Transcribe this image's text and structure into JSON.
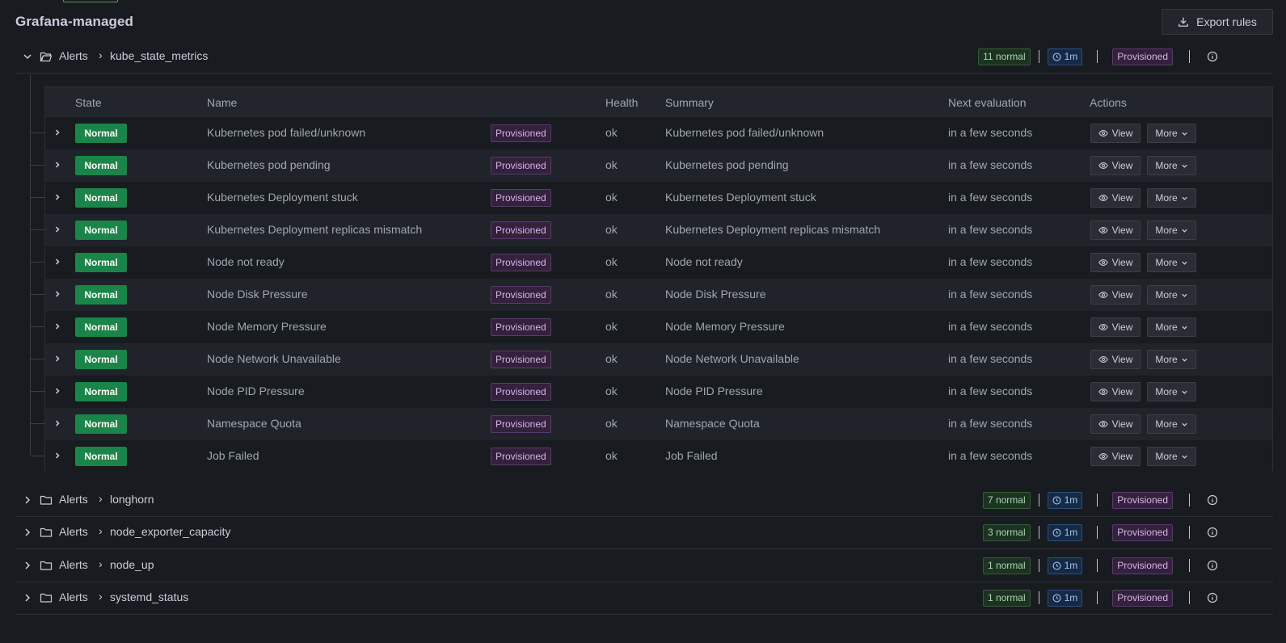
{
  "page": {
    "title": "Grafana-managed",
    "export_label": "Export rules"
  },
  "icons": {
    "export": "download-icon",
    "folder_open": "folder-open-icon",
    "folder": "folder-icon",
    "interval": "clock-icon",
    "info": "info-circle-icon",
    "view": "eye-icon",
    "more": "chevron-down-icon"
  },
  "colors": {
    "state_normal": "#1b8448",
    "provisioned": "#5a3b6a",
    "interval": "#2e4e7c",
    "normal_count": "#37593c"
  },
  "groups": [
    {
      "namespace": "Alerts",
      "separator": "›",
      "name": "kube_state_metrics",
      "normal": "11 normal",
      "interval": "1m",
      "provisioned": "Provisioned",
      "expanded": true
    },
    {
      "namespace": "Alerts",
      "separator": "›",
      "name": "longhorn",
      "normal": "7 normal",
      "interval": "1m",
      "provisioned": "Provisioned",
      "expanded": false
    },
    {
      "namespace": "Alerts",
      "separator": "›",
      "name": "node_exporter_capacity",
      "normal": "3 normal",
      "interval": "1m",
      "provisioned": "Provisioned",
      "expanded": false
    },
    {
      "namespace": "Alerts",
      "separator": "›",
      "name": "node_up",
      "normal": "1 normal",
      "interval": "1m",
      "provisioned": "Provisioned",
      "expanded": false
    },
    {
      "namespace": "Alerts",
      "separator": "›",
      "name": "systemd_status",
      "normal": "1 normal",
      "interval": "1m",
      "provisioned": "Provisioned",
      "expanded": false
    }
  ],
  "table": {
    "headers": {
      "state": "State",
      "name": "Name",
      "health": "Health",
      "summary": "Summary",
      "next_eval": "Next evaluation",
      "actions": "Actions"
    },
    "view_label": "View",
    "more_label": "More",
    "rows": [
      {
        "state": "Normal",
        "name": "Kubernetes pod failed/unknown",
        "badge": "Provisioned",
        "health": "ok",
        "summary": "Kubernetes pod failed/unknown",
        "next": "in a few seconds"
      },
      {
        "state": "Normal",
        "name": "Kubernetes pod pending",
        "badge": "Provisioned",
        "health": "ok",
        "summary": "Kubernetes pod pending",
        "next": "in a few seconds"
      },
      {
        "state": "Normal",
        "name": "Kubernetes Deployment stuck",
        "badge": "Provisioned",
        "health": "ok",
        "summary": "Kubernetes Deployment stuck",
        "next": "in a few seconds"
      },
      {
        "state": "Normal",
        "name": "Kubernetes Deployment replicas mismatch",
        "badge": "Provisioned",
        "health": "ok",
        "summary": "Kubernetes Deployment replicas mismatch",
        "next": "in a few seconds"
      },
      {
        "state": "Normal",
        "name": "Node not ready",
        "badge": "Provisioned",
        "health": "ok",
        "summary": "Node not ready",
        "next": "in a few seconds"
      },
      {
        "state": "Normal",
        "name": "Node Disk Pressure",
        "badge": "Provisioned",
        "health": "ok",
        "summary": "Node Disk Pressure",
        "next": "in a few seconds"
      },
      {
        "state": "Normal",
        "name": "Node Memory Pressure",
        "badge": "Provisioned",
        "health": "ok",
        "summary": "Node Memory Pressure",
        "next": "in a few seconds"
      },
      {
        "state": "Normal",
        "name": "Node Network Unavailable",
        "badge": "Provisioned",
        "health": "ok",
        "summary": "Node Network Unavailable",
        "next": "in a few seconds"
      },
      {
        "state": "Normal",
        "name": "Node PID Pressure",
        "badge": "Provisioned",
        "health": "ok",
        "summary": "Node PID Pressure",
        "next": "in a few seconds"
      },
      {
        "state": "Normal",
        "name": "Namespace Quota",
        "badge": "Provisioned",
        "health": "ok",
        "summary": "Namespace Quota",
        "next": "in a few seconds"
      },
      {
        "state": "Normal",
        "name": "Job Failed",
        "badge": "Provisioned",
        "health": "ok",
        "summary": "Job Failed",
        "next": "in a few seconds"
      }
    ]
  }
}
